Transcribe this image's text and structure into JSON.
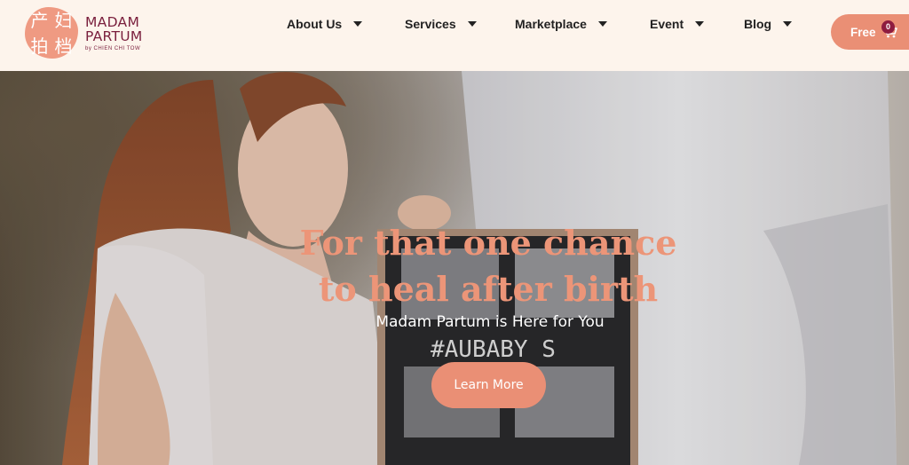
{
  "brand": {
    "mark_chars": [
      "产",
      "妇",
      "拍",
      "档"
    ],
    "name_line1": "MADAM",
    "name_line2": "PARTUM",
    "byline": "by CHIEN CHI TOW"
  },
  "nav": {
    "items": [
      {
        "label": "About Us"
      },
      {
        "label": "Services"
      },
      {
        "label": "Marketplace"
      },
      {
        "label": "Event"
      },
      {
        "label": "Blog"
      }
    ]
  },
  "cart": {
    "label": "Free",
    "count": "0",
    "icon": "shopping-cart-icon"
  },
  "hero": {
    "title_line1": "For that one chance",
    "title_line2": "to heal after birth",
    "subtitle": "Madam Partum is Here for You",
    "cta_label": "Learn More",
    "board_text": "#AUBABY S"
  },
  "colors": {
    "accent": "#ea8f75",
    "brand": "#7a1f3d",
    "header_bg": "#fdf4ec",
    "badge": "#8e1c3f"
  }
}
